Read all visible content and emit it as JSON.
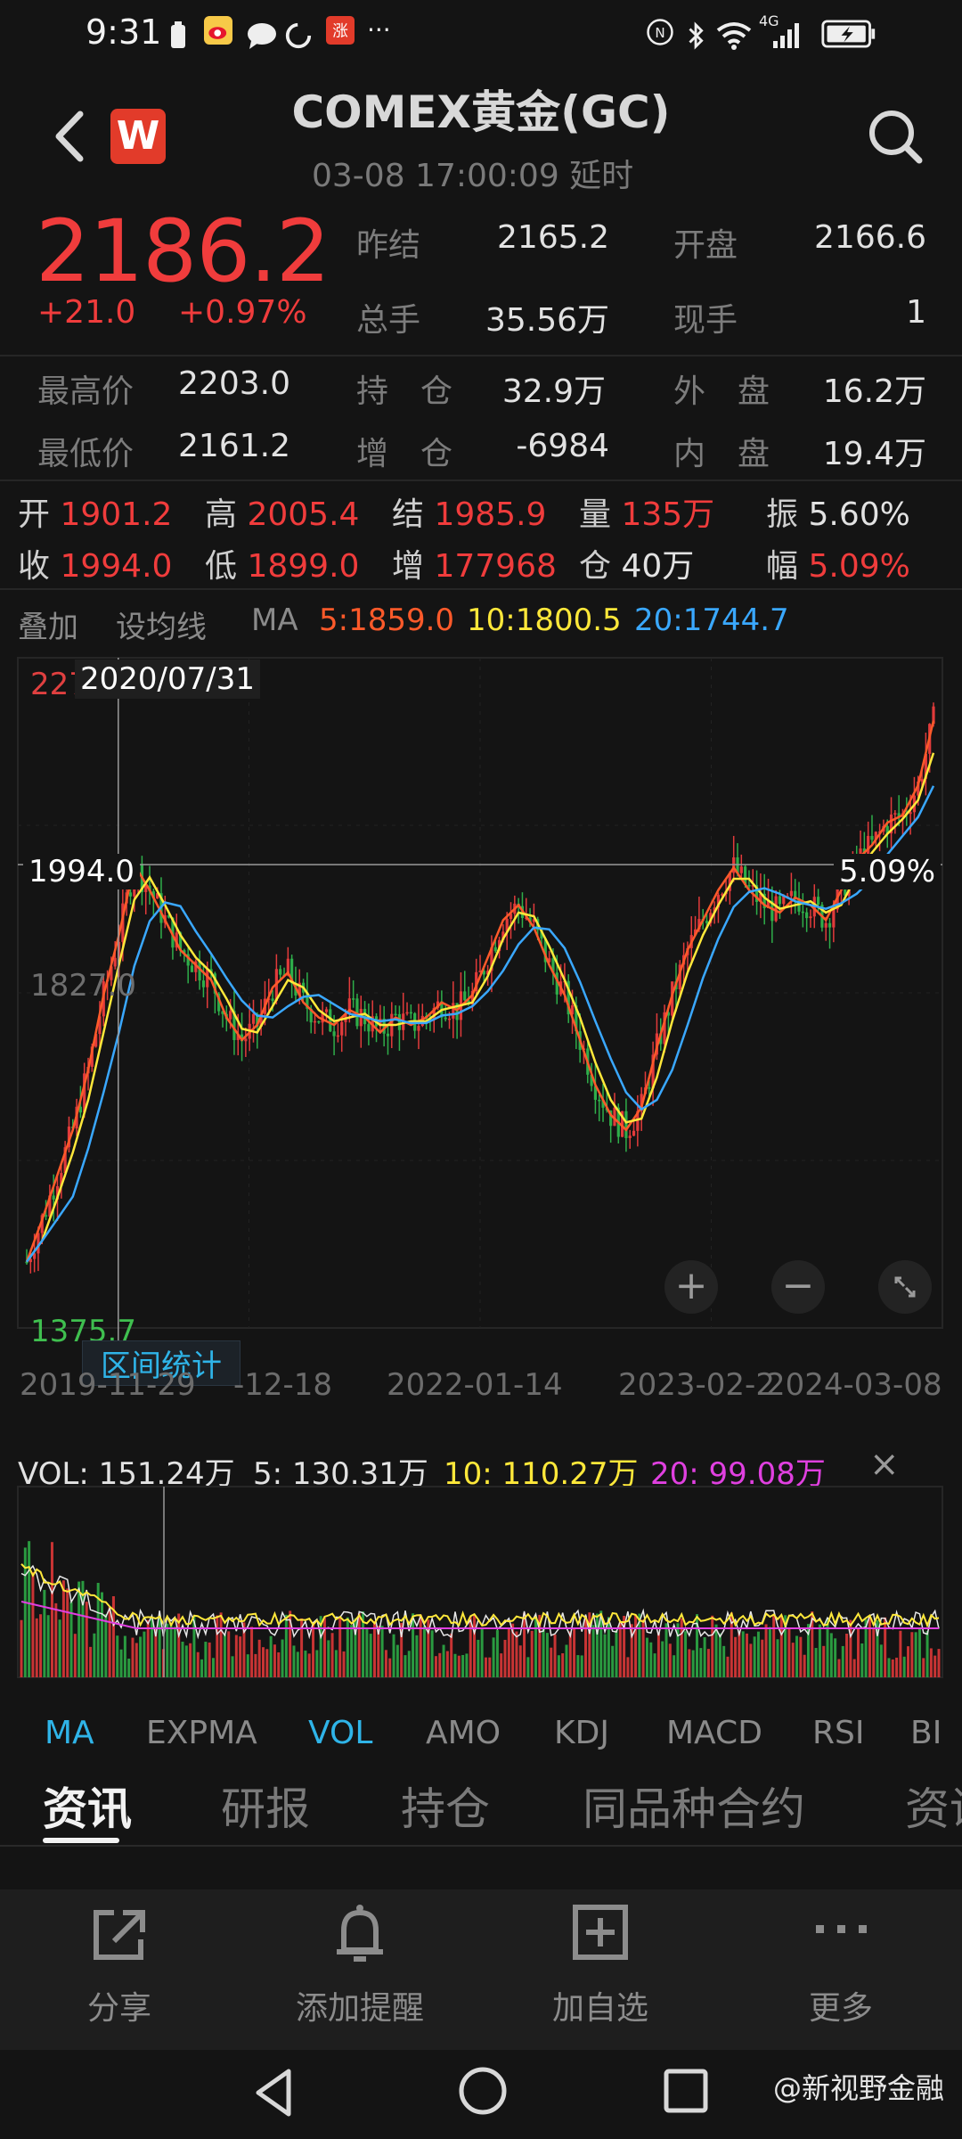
{
  "status_bar": {
    "time": "9:31",
    "icons": [
      "battery-saver-icon",
      "weibo-icon",
      "chat-icon",
      "loading-icon",
      "zhang-app-icon",
      "more-dots-icon"
    ],
    "right_icons": [
      "nfc-icon",
      "bluetooth-icon",
      "wifi-icon",
      "signal-4g-icon",
      "battery-charging-icon"
    ],
    "more": "···",
    "network": "4G"
  },
  "header": {
    "title": "COMEX黄金(GC)",
    "subtitle": "03-08 17:00:09  延时",
    "logo_text": "W"
  },
  "quote": {
    "price": "2186.2",
    "change": "+21.0",
    "change_pct": "+0.97%",
    "fields": {
      "prev_settle_label": "昨结",
      "prev_settle": "2165.2",
      "open_label": "开盘",
      "open": "2166.6",
      "volume_label": "总手",
      "volume": "35.56万",
      "last_vol_label": "现手",
      "last_vol": "1",
      "high_label": "最高价",
      "high": "2203.0",
      "oi_label": "持　仓",
      "oi": "32.9万",
      "outer_label": "外　盘",
      "outer": "16.2万",
      "low_label": "最低价",
      "low": "2161.2",
      "oi_chg_label": "增　仓",
      "oi_chg": "-6984",
      "inner_label": "内　盘",
      "inner": "19.4万"
    }
  },
  "candle_info": {
    "open_label": "开",
    "open": "1901.2",
    "high_label": "高",
    "high": "2005.4",
    "settle_label": "结",
    "settle": "1985.9",
    "vol_label": "量",
    "vol": "135万",
    "amp_label": "振",
    "amp": "5.60%",
    "close_label": "收",
    "close": "1994.0",
    "low_label": "低",
    "low": "1899.0",
    "oi_add_label": "增",
    "oi_add": "177968",
    "oi_label": "仓",
    "oi": "40万",
    "range_label": "幅",
    "range": "5.09%"
  },
  "ma_bar": {
    "overlay": "叠加",
    "set_ma": "设均线",
    "ma_label": "MA",
    "ma5": "5:1859.0",
    "ma10": "10:1800.5",
    "ma20": "20:1744.7",
    "colors": {
      "ma5": "#ff5a2a",
      "ma10": "#ffe83a",
      "ma20": "#3aa8ff"
    }
  },
  "chart": {
    "top_price": "227",
    "crosshair_date": "2020/07/31",
    "crosshair_price": "1994.0",
    "crosshair_pct": "5.09%",
    "mid_price": "1827.0",
    "bottom_price": "1375.7",
    "range_stats": "区间统计",
    "dates": [
      "2019-11-29",
      "-12-18",
      "2022-01-14",
      "2023-02-2",
      "2024-03-08"
    ],
    "zoom_in": "+",
    "zoom_out": "−"
  },
  "chart_data": {
    "type": "candlestick",
    "x": [
      "2019-11-29",
      "2022-01-14",
      "2023-02",
      "2024-03-08"
    ],
    "ylim": [
      1375.7,
      2270
    ],
    "series": [
      {
        "values": [
          1464,
          1520,
          1580,
          1640,
          1720,
          1820,
          1900,
          1994,
          1960,
          1920,
          1880,
          1860,
          1840,
          1790,
          1760,
          1780,
          1830,
          1850,
          1810,
          1790,
          1780,
          1800,
          1790,
          1770,
          1790,
          1780,
          1790,
          1810,
          1800,
          1820,
          1870,
          1920,
          1940,
          1910,
          1860,
          1820,
          1760,
          1700,
          1660,
          1640,
          1670,
          1750,
          1820,
          1880,
          1920,
          1960,
          1990,
          1960,
          1940,
          1930,
          1950,
          1940,
          1920,
          1960,
          2000,
          2020,
          2050,
          2060,
          2100,
          2186
        ]
      }
    ]
  },
  "volume": {
    "vol": "VOL: 151.24万",
    "v5": "5: 130.31万",
    "v10": "10: 110.27万",
    "v20": "20: 99.08万",
    "close": "×"
  },
  "indicator_tabs": [
    "MA",
    "EXPMA",
    "VOL",
    "AMO",
    "KDJ",
    "MACD",
    "RSI",
    "BI"
  ],
  "section_tabs": [
    "资讯",
    "研报",
    "持仓",
    "同品种合约",
    "资讯"
  ],
  "actions": [
    "分享",
    "添加提醒",
    "加自选",
    "更多"
  ],
  "watermark": "@新视野金融"
}
